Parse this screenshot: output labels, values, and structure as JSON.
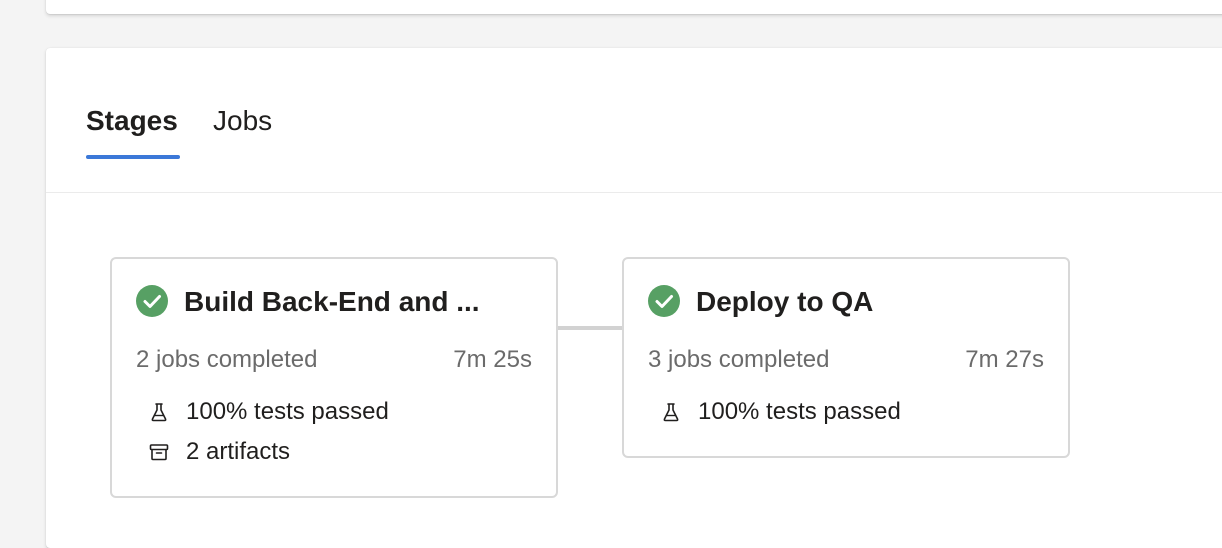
{
  "tabs": {
    "stages_label": "Stages",
    "jobs_label": "Jobs",
    "active": "Stages"
  },
  "colors": {
    "success": "#57a064",
    "tab_indicator": "#3b78d8"
  },
  "stages": [
    {
      "title": "Build Back-End and ...",
      "status": "succeeded",
      "status_icon": "check-circle-icon",
      "jobs_completed": "2 jobs completed",
      "duration": "7m 25s",
      "tests": "100% tests passed",
      "tests_icon": "flask-icon",
      "artifacts": "2 artifacts",
      "artifacts_icon": "archive-icon"
    },
    {
      "title": "Deploy to QA",
      "status": "succeeded",
      "status_icon": "check-circle-icon",
      "jobs_completed": "3 jobs completed",
      "duration": "7m 27s",
      "tests": "100% tests passed",
      "tests_icon": "flask-icon"
    }
  ]
}
